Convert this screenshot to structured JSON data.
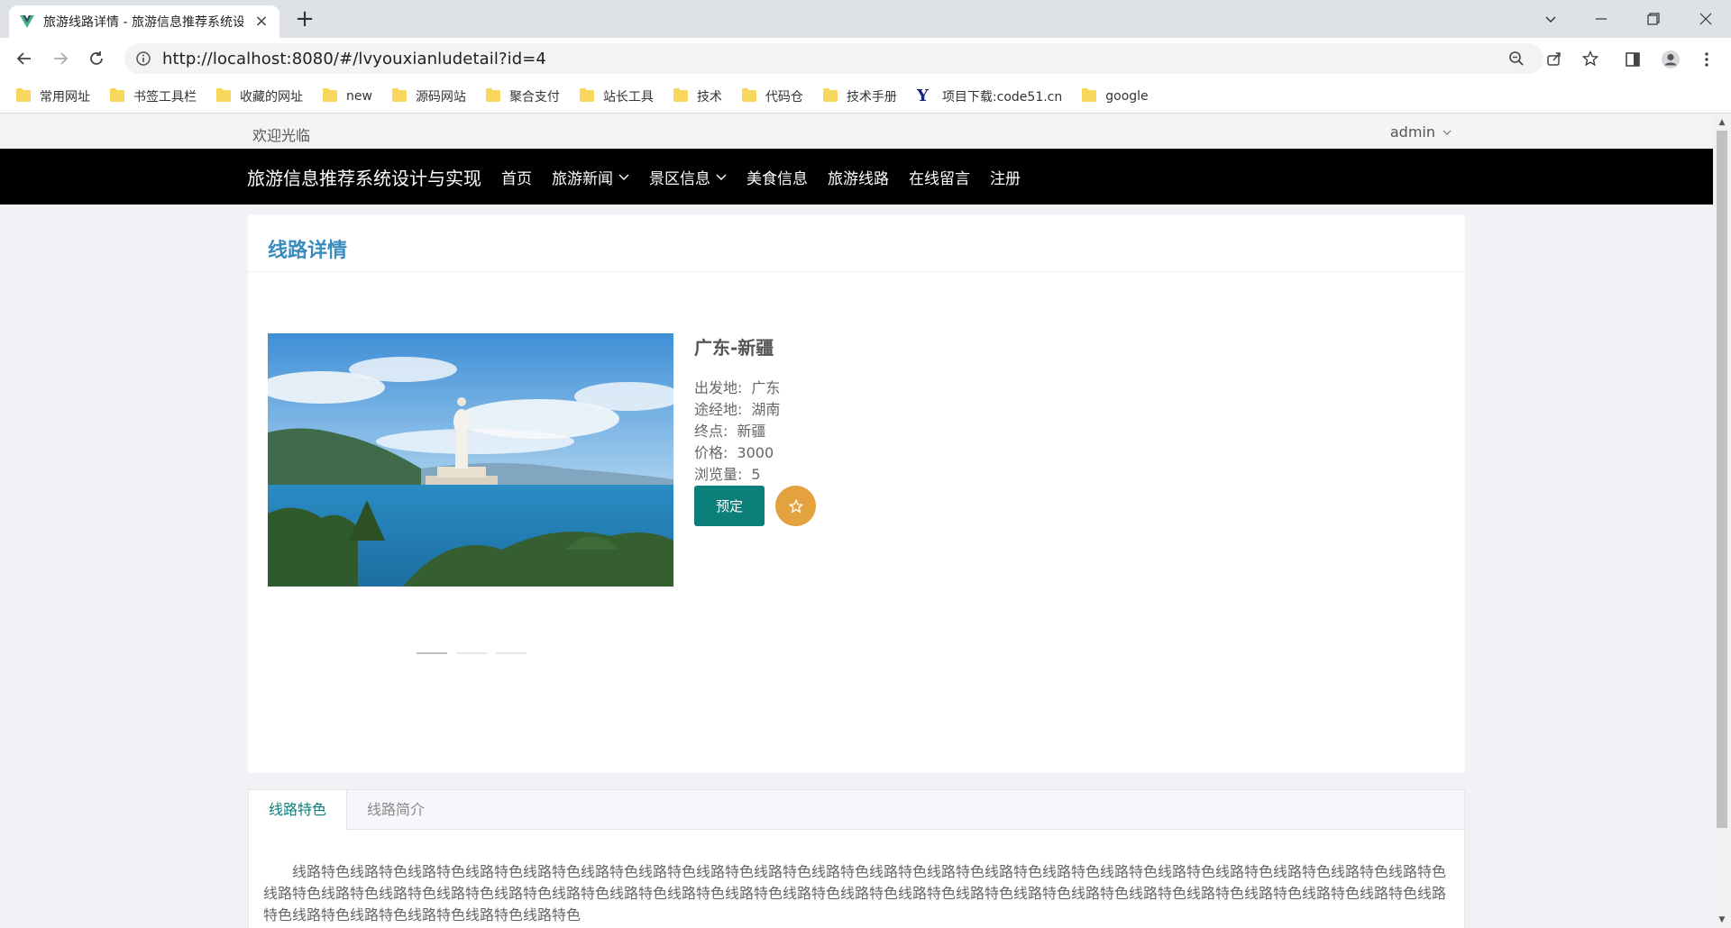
{
  "browser": {
    "tab_title": "旅游线路详情 - 旅游信息推荐系统设计与实现",
    "url": "http://localhost:8080/#/lvyouxianludetail?id=4",
    "bookmarks": [
      "常用网址",
      "书签工具栏",
      "收藏的网址",
      "new",
      "源码网站",
      "聚合支付",
      "站长工具",
      "技术",
      "代码仓",
      "技术手册",
      "项目下载:code51.cn",
      "google"
    ]
  },
  "topbar": {
    "welcome": "欢迎光临",
    "user": "admin"
  },
  "nav": {
    "brand": "旅游信息推荐系统设计与实现",
    "items": [
      "首页",
      "旅游新闻",
      "景区信息",
      "美食信息",
      "旅游线路",
      "在线留言",
      "注册"
    ]
  },
  "detail": {
    "heading": "线路详情",
    "route_name": "广东-新疆",
    "fields": [
      {
        "label": "出发地:",
        "value": "广东"
      },
      {
        "label": "途经地:",
        "value": "湖南"
      },
      {
        "label": "终点:",
        "value": "新疆"
      },
      {
        "label": "价格:",
        "value": "3000"
      },
      {
        "label": "浏览量:",
        "value": "5"
      }
    ],
    "book_label": "预定",
    "carousel_index": 1,
    "carousel_count": 3
  },
  "tabs": {
    "items": [
      "线路特色",
      "线路简介"
    ],
    "active": "线路特色",
    "content": "线路特色线路特色线路特色线路特色线路特色线路特色线路特色线路特色线路特色线路特色线路特色线路特色线路特色线路特色线路特色线路特色线路特色线路特色线路特色线路特色线路特色线路特色线路特色线路特色线路特色线路特色线路特色线路特色线路特色线路特色线路特色线路特色线路特色线路特色线路特色线路特色线路特色线路特色线路特色线路特色线路特色线路特色线路特色线路特色线路特色线路特色"
  },
  "colors": {
    "nav_bg": "#000000",
    "heading": "#3a8cbf",
    "primary": "#0c7f7b",
    "favorite": "#e4a23f"
  }
}
